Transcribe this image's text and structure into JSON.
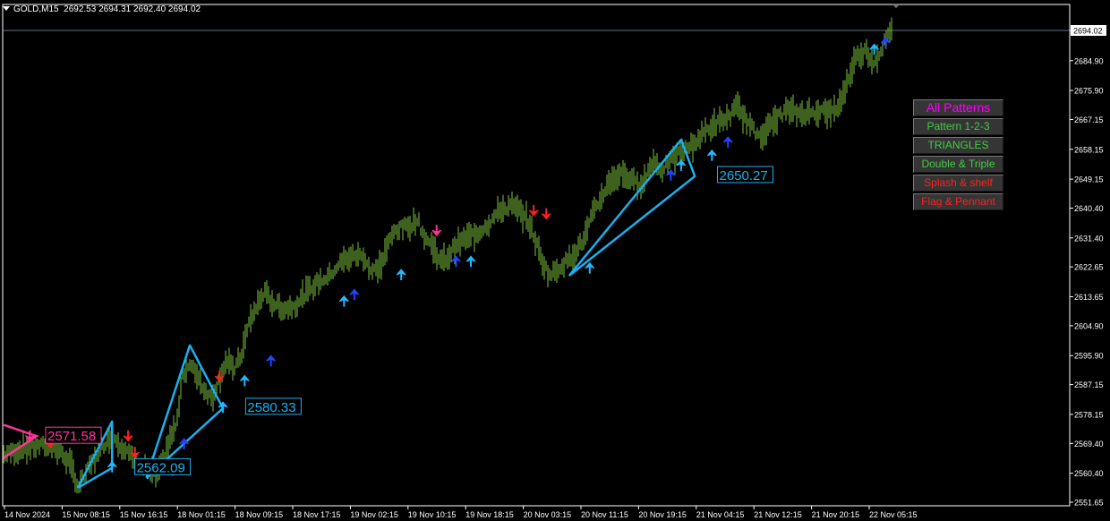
{
  "header": {
    "symbol": "GOLD,M15",
    "ohlc": "2692.53 2694.31 2692.40 2694.02"
  },
  "colors": {
    "background": "#000000",
    "bars": "#7cc43c",
    "grid": "#ffffff",
    "pattern_line": "#1ab0f0",
    "arrow_up_blue": "#2244ff",
    "arrow_up_cyan": "#22b8ff",
    "arrow_down_red": "#ff2020",
    "arrow_down_pink": "#ff3399",
    "level_blue": "#1ab0f0",
    "level_pink": "#ff3399",
    "btn_magenta": "#ff00ff",
    "btn_green": "#44cc44",
    "btn_red": "#ff2020"
  },
  "panel": {
    "buttons": [
      {
        "label": "All Patterns",
        "color": "#ff00ff",
        "big": true
      },
      {
        "label": "Pattern 1-2-3",
        "color": "#44cc44"
      },
      {
        "label": "TRIANGLES",
        "color": "#44cc44"
      },
      {
        "label": "Double & Triple",
        "color": "#44cc44"
      },
      {
        "label": "Splash & shelf",
        "color": "#ff2020"
      },
      {
        "label": "Flag & Pennant",
        "color": "#ff2020"
      }
    ]
  },
  "chart_data": {
    "type": "candlestick",
    "symbol": "GOLD",
    "timeframe": "M15",
    "current_price": 2694.02,
    "ylim": [
      2551.65,
      2699.0
    ],
    "y_ticks": [
      "2694.02",
      "2684.90",
      "2675.90",
      "2667.15",
      "2658.15",
      "2649.15",
      "2640.40",
      "2631.40",
      "2622.65",
      "2613.65",
      "2604.90",
      "2595.90",
      "2587.15",
      "2578.15",
      "2569.40",
      "2560.40",
      "2551.65"
    ],
    "x_ticks": [
      "14 Nov 2024",
      "15 Nov 08:15",
      "15 Nov 16:15",
      "18 Nov 01:15",
      "18 Nov 09:15",
      "18 Nov 17:15",
      "19 Nov 02:15",
      "19 Nov 10:15",
      "19 Nov 18:15",
      "20 Nov 03:15",
      "20 Nov 11:15",
      "20 Nov 19:15",
      "21 Nov 04:15",
      "21 Nov 12:15",
      "21 Nov 20:15",
      "22 Nov 05:15"
    ],
    "price_path": [
      [
        0,
        2566
      ],
      [
        2,
        2568
      ],
      [
        4,
        2569
      ],
      [
        5,
        2567
      ],
      [
        6,
        2562
      ],
      [
        6.5,
        2556
      ],
      [
        7.5,
        2562
      ],
      [
        8.5,
        2568
      ],
      [
        9.5,
        2572
      ],
      [
        10.5,
        2568
      ],
      [
        11.5,
        2564
      ],
      [
        12.5,
        2562
      ],
      [
        13.5,
        2560
      ],
      [
        14,
        2564
      ],
      [
        14.5,
        2570
      ],
      [
        15.2,
        2576
      ],
      [
        15.6,
        2590
      ],
      [
        16.2,
        2593
      ],
      [
        17,
        2590
      ],
      [
        17.5,
        2586
      ],
      [
        18.2,
        2583
      ],
      [
        18.8,
        2588
      ],
      [
        19.4,
        2594
      ],
      [
        20.2,
        2592
      ],
      [
        20.8,
        2596
      ],
      [
        21.5,
        2606
      ],
      [
        22.2,
        2611
      ],
      [
        22.8,
        2615
      ],
      [
        23.5,
        2612
      ],
      [
        24.5,
        2610
      ],
      [
        25.5,
        2611
      ],
      [
        26.5,
        2615
      ],
      [
        27.5,
        2618
      ],
      [
        28.5,
        2620
      ],
      [
        29.5,
        2624
      ],
      [
        30.5,
        2626
      ],
      [
        31.5,
        2626
      ],
      [
        32.2,
        2621
      ],
      [
        33,
        2623
      ],
      [
        33.6,
        2629
      ],
      [
        34.3,
        2634
      ],
      [
        35.5,
        2635
      ],
      [
        36.2,
        2637
      ],
      [
        36.8,
        2632
      ],
      [
        37.5,
        2629
      ],
      [
        38.3,
        2624
      ],
      [
        39,
        2626
      ],
      [
        39.5,
        2629
      ],
      [
        40.3,
        2631
      ],
      [
        41.5,
        2633
      ],
      [
        42.5,
        2636
      ],
      [
        43.5,
        2640
      ],
      [
        44.5,
        2641
      ],
      [
        45.3,
        2639
      ],
      [
        46,
        2636
      ],
      [
        46.6,
        2630
      ],
      [
        47.2,
        2624
      ],
      [
        47.8,
        2620
      ],
      [
        48.8,
        2623
      ],
      [
        49.8,
        2626
      ],
      [
        50.8,
        2631
      ],
      [
        51.5,
        2638
      ],
      [
        52.5,
        2645
      ],
      [
        53.2,
        2649
      ],
      [
        54.2,
        2651
      ],
      [
        55.2,
        2648
      ],
      [
        56,
        2648
      ],
      [
        56.8,
        2655
      ],
      [
        57.6,
        2652
      ],
      [
        58.5,
        2655
      ],
      [
        59.5,
        2658
      ],
      [
        60.5,
        2660
      ],
      [
        61.5,
        2664
      ],
      [
        62.5,
        2666
      ],
      [
        63.5,
        2668
      ],
      [
        64.2,
        2671
      ],
      [
        65,
        2667
      ],
      [
        65.8,
        2663
      ],
      [
        66.5,
        2663
      ],
      [
        67.5,
        2667
      ],
      [
        68.5,
        2670
      ],
      [
        69.5,
        2669
      ],
      [
        70.5,
        2669
      ],
      [
        71.5,
        2670
      ],
      [
        72.5,
        2669
      ],
      [
        73.2,
        2672
      ],
      [
        74,
        2680
      ],
      [
        74.6,
        2686
      ],
      [
        75.5,
        2688
      ],
      [
        76.2,
        2684
      ],
      [
        77,
        2690
      ],
      [
        77.8,
        2694
      ]
    ],
    "patterns": [
      {
        "points": [
          [
            6.5,
            2556
          ],
          [
            9.5,
            2576
          ],
          [
            9.5,
            2562
          ],
          [
            6.5,
            2556
          ]
        ]
      },
      {
        "points": [
          [
            12.5,
            2559
          ],
          [
            16.3,
            2599
          ],
          [
            19.2,
            2580
          ],
          [
            12.5,
            2559
          ]
        ]
      },
      {
        "points": [
          [
            49.5,
            2620
          ],
          [
            59.3,
            2661
          ],
          [
            60.5,
            2650
          ],
          [
            49.5,
            2620
          ]
        ]
      }
    ],
    "levels": [
      {
        "label": "2571.58",
        "color": "pink",
        "t": 2.9,
        "price": 2571.58
      },
      {
        "label": "2562.09",
        "color": "blue",
        "t": 10.7,
        "price": 2562.09
      },
      {
        "label": "2580.33",
        "color": "blue",
        "t": 20.4,
        "price": 2580.33
      },
      {
        "label": "2650.27",
        "color": "blue",
        "t": 61.7,
        "price": 2650.27
      }
    ],
    "signals": [
      {
        "type": "up",
        "t": 9.5,
        "price": 2562,
        "c": "cyan"
      },
      {
        "type": "up",
        "t": 12.6,
        "price": 2560,
        "c": "cyan"
      },
      {
        "type": "up",
        "t": 14.8,
        "price": 2561,
        "c": "cyan"
      },
      {
        "type": "up",
        "t": 15.8,
        "price": 2569,
        "c": "blue"
      },
      {
        "type": "up",
        "t": 19.2,
        "price": 2580,
        "c": "cyan"
      },
      {
        "type": "up",
        "t": 21.1,
        "price": 2588,
        "c": "cyan"
      },
      {
        "type": "up",
        "t": 23.4,
        "price": 2594,
        "c": "blue"
      },
      {
        "type": "up",
        "t": 29.8,
        "price": 2612,
        "c": "cyan"
      },
      {
        "type": "up",
        "t": 30.7,
        "price": 2614,
        "c": "blue"
      },
      {
        "type": "up",
        "t": 34.8,
        "price": 2620,
        "c": "cyan"
      },
      {
        "type": "up",
        "t": 39.6,
        "price": 2624,
        "c": "blue"
      },
      {
        "type": "up",
        "t": 40.9,
        "price": 2624,
        "c": "cyan"
      },
      {
        "type": "up",
        "t": 51.3,
        "price": 2622,
        "c": "cyan"
      },
      {
        "type": "up",
        "t": 58.4,
        "price": 2650,
        "c": "blue"
      },
      {
        "type": "up",
        "t": 59.3,
        "price": 2653,
        "c": "cyan"
      },
      {
        "type": "up",
        "t": 62.0,
        "price": 2656,
        "c": "cyan"
      },
      {
        "type": "up",
        "t": 63.4,
        "price": 2660,
        "c": "blue"
      },
      {
        "type": "up",
        "t": 76.2,
        "price": 2688,
        "c": "cyan"
      },
      {
        "type": "up",
        "t": 77.2,
        "price": 2690,
        "c": "blue"
      },
      {
        "type": "down",
        "t": 2.3,
        "price": 2572,
        "c": "pink"
      },
      {
        "type": "down",
        "t": 4.1,
        "price": 2570,
        "c": "red"
      },
      {
        "type": "down",
        "t": 10.9,
        "price": 2572,
        "c": "red"
      },
      {
        "type": "down",
        "t": 11.5,
        "price": 2567,
        "c": "red"
      },
      {
        "type": "down",
        "t": 18.9,
        "price": 2590,
        "c": "red"
      },
      {
        "type": "down",
        "t": 37.9,
        "price": 2634,
        "c": "pink"
      },
      {
        "type": "down",
        "t": 46.4,
        "price": 2640,
        "c": "red"
      },
      {
        "type": "down",
        "t": 47.5,
        "price": 2639,
        "c": "red"
      }
    ]
  }
}
